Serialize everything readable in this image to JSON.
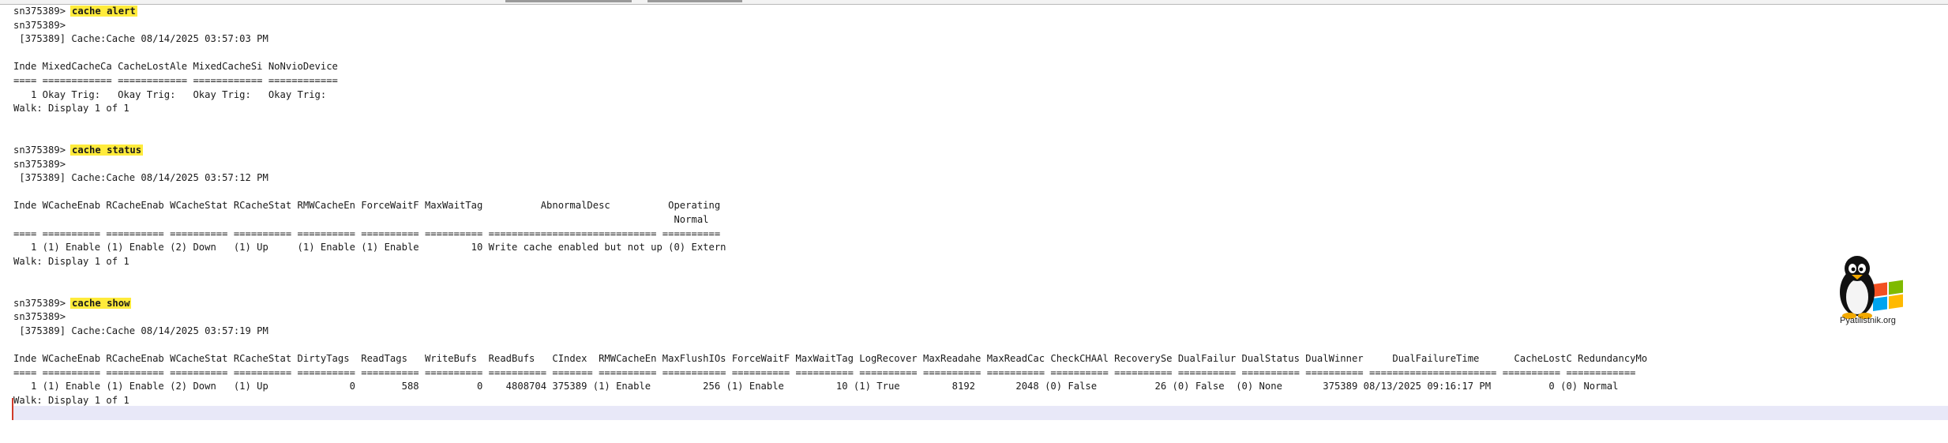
{
  "lines": [
    {
      "kind": "cmd",
      "prompt": "sn375389>",
      "command": "cache alert"
    },
    {
      "kind": "text",
      "text": "sn375389>"
    },
    {
      "kind": "text",
      "text": " [375389] Cache:Cache 08/14/2025 03:57:03 PM"
    },
    {
      "kind": "text",
      "text": ""
    },
    {
      "kind": "text",
      "text": "Inde MixedCacheCa CacheLostAle MixedCacheSi NoNvioDevice"
    },
    {
      "kind": "text",
      "text": "==== ============ ============ ============ ============"
    },
    {
      "kind": "text",
      "text": "   1 Okay Trig:   Okay Trig:   Okay Trig:   Okay Trig:"
    },
    {
      "kind": "text",
      "text": "Walk: Display 1 of 1"
    },
    {
      "kind": "text",
      "text": ""
    },
    {
      "kind": "text",
      "text": ""
    },
    {
      "kind": "cmd",
      "prompt": "sn375389>",
      "command": "cache status"
    },
    {
      "kind": "text",
      "text": "sn375389>"
    },
    {
      "kind": "text",
      "text": " [375389] Cache:Cache 08/14/2025 03:57:12 PM"
    },
    {
      "kind": "text",
      "text": ""
    },
    {
      "kind": "text",
      "text": "Inde WCacheEnab RCacheEnab WCacheStat RCacheStat RMWCacheEn ForceWaitF MaxWaitTag          AbnormalDesc          Operating"
    },
    {
      "kind": "text",
      "text": "                                                                                                                  Normal"
    },
    {
      "kind": "text",
      "text": "==== ========== ========== ========== ========== ========== ========== ========== ============================= =========="
    },
    {
      "kind": "text",
      "text": "   1 (1) Enable (1) Enable (2) Down   (1) Up     (1) Enable (1) Enable         10 Write cache enabled but not up (0) Extern"
    },
    {
      "kind": "text",
      "text": "Walk: Display 1 of 1"
    },
    {
      "kind": "text",
      "text": ""
    },
    {
      "kind": "text",
      "text": ""
    },
    {
      "kind": "cmd",
      "prompt": "sn375389>",
      "command": "cache show"
    },
    {
      "kind": "text",
      "text": "sn375389>"
    },
    {
      "kind": "text",
      "text": " [375389] Cache:Cache 08/14/2025 03:57:19 PM"
    },
    {
      "kind": "text",
      "text": ""
    },
    {
      "kind": "text",
      "text": "Inde WCacheEnab RCacheEnab WCacheStat RCacheStat DirtyTags  ReadTags   WriteBufs  ReadBufs   CIndex  RMWCacheEn MaxFlushIOs ForceWaitF MaxWaitTag LogRecover MaxReadahe MaxReadCac CheckCHAAl RecoverySe DualFailur DualStatus DualWinner     DualFailureTime      CacheLostC RedundancyMo"
    },
    {
      "kind": "text",
      "text": "==== ========== ========== ========== ========== ========== ========== ========== ========== ======= ========== =========== ========== ========== ========== ========== ========== ========== ========== ========== ========== ========== ====================== ========== ============"
    },
    {
      "kind": "text",
      "text": "   1 (1) Enable (1) Enable (2) Down   (1) Up              0        588          0    4808704 375389 (1) Enable         256 (1) Enable         10 (1) True         8192       2048 (0) False          26 (0) False  (0) None       375389 08/13/2025 09:16:17 PM          0 (0) Normal"
    },
    {
      "kind": "text",
      "text": "Walk: Display 1 of 1"
    }
  ],
  "logo": {
    "text": "Pyatilistnik.org",
    "icon": "penguin-windows-logo-icon"
  },
  "colors": {
    "highlight": "#ffeb3b",
    "background": "#ffffff",
    "text": "#1a1a1a"
  }
}
